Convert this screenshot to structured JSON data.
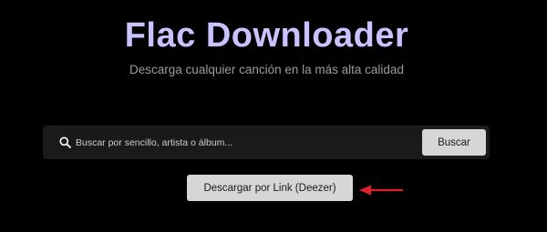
{
  "header": {
    "title": "Flac Downloader",
    "subtitle": "Descarga cualquier canción en la más alta calidad"
  },
  "search": {
    "placeholder": "Buscar por sencillo, artista o álbum...",
    "value": "",
    "button_label": "Buscar"
  },
  "link_download": {
    "button_label": "Descargar por Link (Deezer)"
  },
  "icons": {
    "search": "search-icon",
    "annotation_arrow": "arrow-left-icon"
  },
  "colors": {
    "background": "#000000",
    "title": "#c8c2ff",
    "subtitle": "#9c9c9c",
    "search_bar": "#1a1a1a",
    "button": "#d6d6d6",
    "annotation_arrow": "#e0212b"
  }
}
